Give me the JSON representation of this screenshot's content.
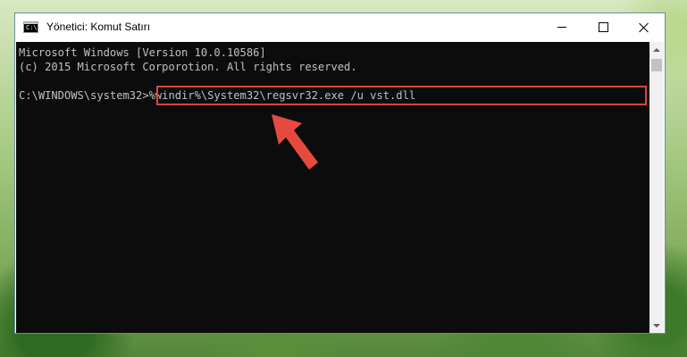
{
  "window": {
    "title": "Yönetici: Komut Satırı",
    "icon_name": "command-prompt-icon",
    "icon_glyph": "C:\\"
  },
  "console": {
    "lines": [
      "Microsoft Windows [Version 10.0.10586]",
      "(c) 2015 Microsoft Corporotion. All rights reserved."
    ],
    "prompt": "C:\\WINDOWS\\system32>",
    "command": "%windir%\\System32\\regsvr32.exe /u vst.dll"
  },
  "colors": {
    "console_background": "#0c0c0c",
    "console_text": "#c0c0c0",
    "highlight": "#e04040",
    "arrow": "#e64a3f"
  },
  "annotation": {
    "arrow_icon_name": "pointer-arrow-icon"
  }
}
